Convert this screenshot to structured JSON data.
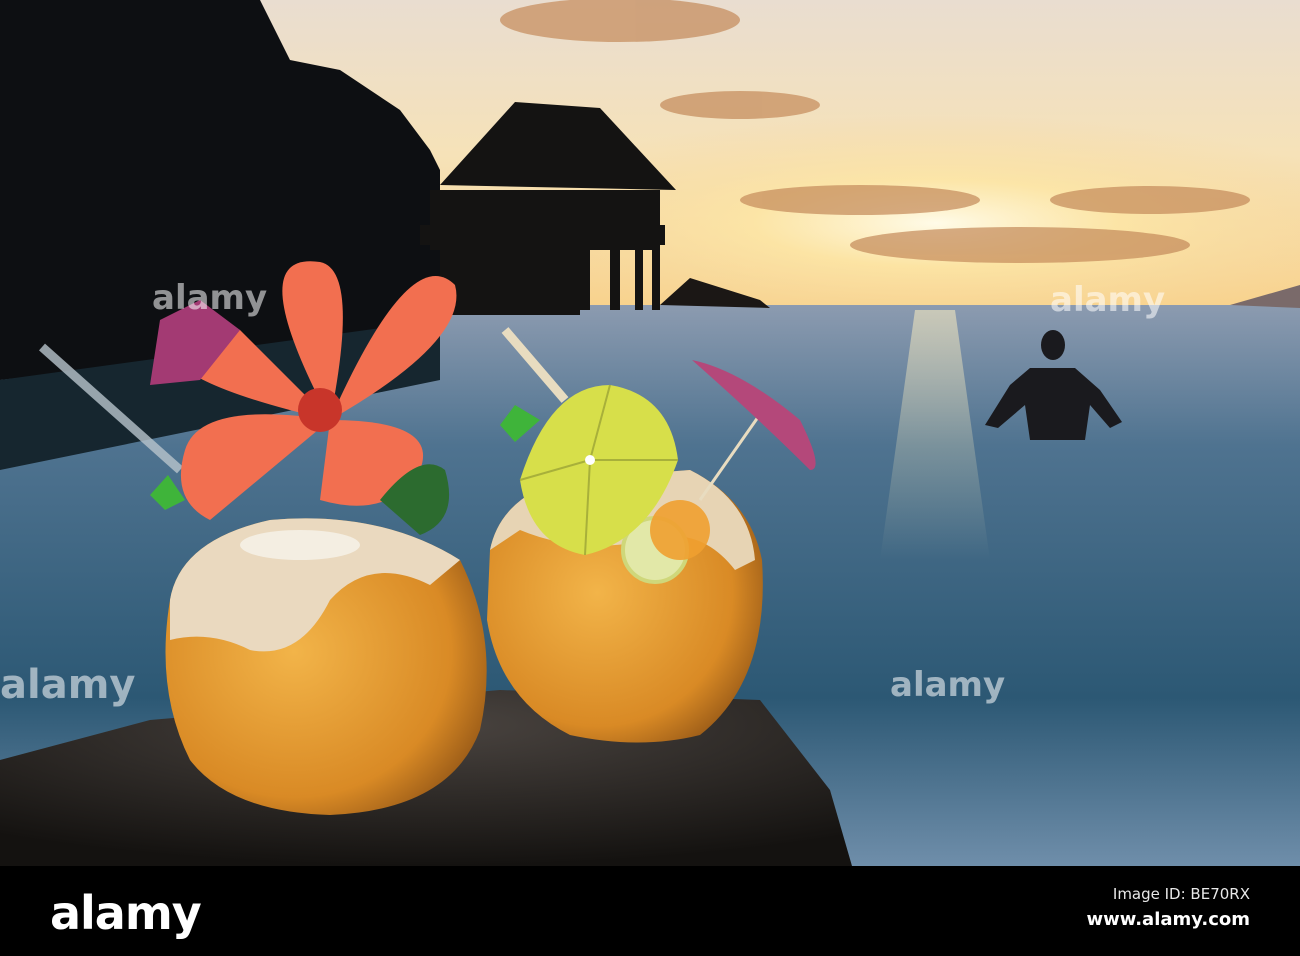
{
  "photo": {
    "subject": "coconut-cocktails-at-sunset",
    "colors": {
      "sky_top": "#f4e6cf",
      "sun": "#fff2c2",
      "sea": "#2f5a78",
      "sea_dark": "#123447",
      "coconut": "#e39a2e",
      "hibiscus": "#f0704e",
      "umbrella_yellow": "#d8e04a",
      "umbrella_pink": "#b2477a"
    }
  },
  "watermark": {
    "text": "alamy"
  },
  "footer": {
    "logo": "alamy",
    "image_id": "Image ID: BE70RX",
    "url": "www.alamy.com"
  }
}
